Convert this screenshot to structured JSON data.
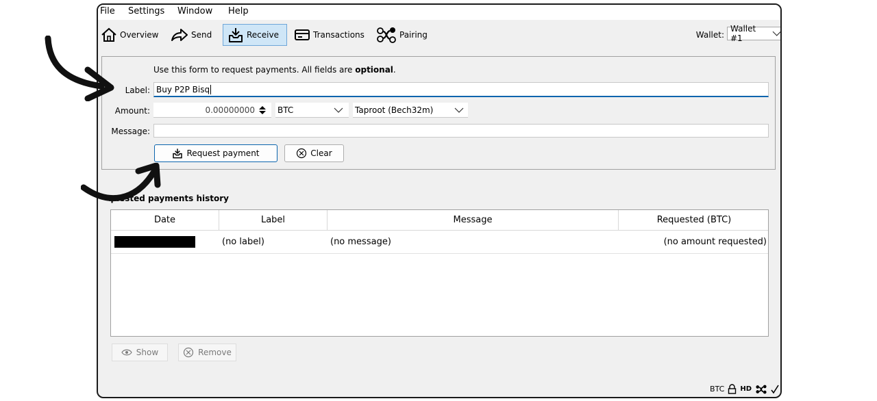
{
  "menubar": {
    "file": "File",
    "settings": "Settings",
    "window": "Window",
    "help": "Help"
  },
  "toolbar": {
    "overview": "Overview",
    "send": "Send",
    "receive": "Receive",
    "transactions": "Transactions",
    "pairing": "Pairing",
    "wallet_label": "Wallet:",
    "wallet_value": "Wallet #1"
  },
  "form": {
    "intro": "Use this form to request payments. All fields are ",
    "intro_bold": "optional",
    "intro_end": ".",
    "label_label": "Label:",
    "label_value": "Buy P2P Bisq",
    "amount_label": "Amount:",
    "amount_value": "0.00000000",
    "unit": "BTC",
    "address_type": "Taproot (Bech32m)",
    "message_label": "Message:",
    "message_value": "",
    "request_button": "Request payment",
    "clear_button": "Clear"
  },
  "history": {
    "title": "quested payments history",
    "columns": [
      "Date",
      "Label",
      "Message",
      "Requested (BTC)"
    ],
    "rows": [
      {
        "date": "",
        "label": "(no label)",
        "message": "(no message)",
        "requested": "(no amount requested)"
      }
    ]
  },
  "footer": {
    "show": "Show",
    "remove": "Remove"
  },
  "status": {
    "unit": "BTC",
    "hd": "HD"
  },
  "colors": {
    "accent": "#0a64ad",
    "active_tab": "#cfe6f7"
  }
}
